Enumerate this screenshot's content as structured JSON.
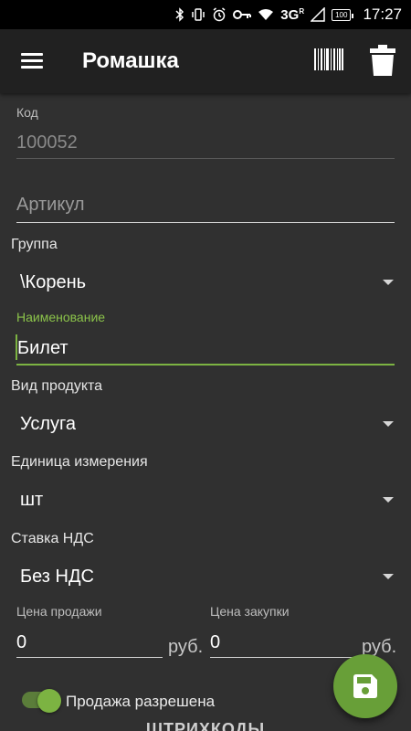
{
  "status_bar": {
    "network": "3G",
    "network_sup": "R",
    "battery": "100",
    "time": "17:27",
    "icons": [
      "bluetooth-icon",
      "vibrate-icon",
      "alarm-icon",
      "key-icon",
      "wifi-icon",
      "signal-icon",
      "battery-icon"
    ]
  },
  "app_bar": {
    "title": "Ромашка",
    "actions": [
      "menu-icon",
      "barcode-icon",
      "trash-icon"
    ]
  },
  "form": {
    "code": {
      "label": "Код",
      "value": "100052"
    },
    "article": {
      "placeholder": "Артикул",
      "value": ""
    },
    "group": {
      "label": "Группа",
      "value": "\\Корень"
    },
    "name": {
      "label": "Наименование",
      "value": "Билет"
    },
    "product_type": {
      "label": "Вид продукта",
      "value": "Услуга"
    },
    "unit": {
      "label": "Единица измерения",
      "value": "шт"
    },
    "vat": {
      "label": "Ставка НДС",
      "value": "Без НДС"
    },
    "sale_price": {
      "label": "Цена продажи",
      "value": "0",
      "currency": "руб."
    },
    "purchase_price": {
      "label": "Цена закупки",
      "value": "0",
      "currency": "руб."
    },
    "sale_allowed": {
      "label": "Продажа разрешена",
      "enabled": true
    },
    "barcodes_heading": "ШТРИХКОДЫ"
  },
  "colors": {
    "accent": "#7cb342",
    "fab": "#689f38",
    "background": "#303030",
    "app_bar": "#212121"
  }
}
